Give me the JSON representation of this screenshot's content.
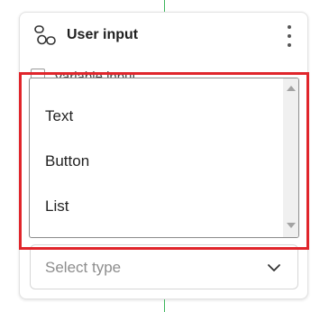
{
  "card": {
    "title": "User input",
    "behind_label": "Variable input"
  },
  "dropdown": {
    "options": [
      "Text",
      "Button",
      "List"
    ]
  },
  "type_select": {
    "placeholder": "Select type"
  },
  "colors": {
    "connector": "#3cb55b",
    "highlight": "#e0252b"
  },
  "icons": {
    "header": "user-input-icon",
    "menu": "kebab-menu-icon",
    "chevron": "chevron-down-icon"
  }
}
